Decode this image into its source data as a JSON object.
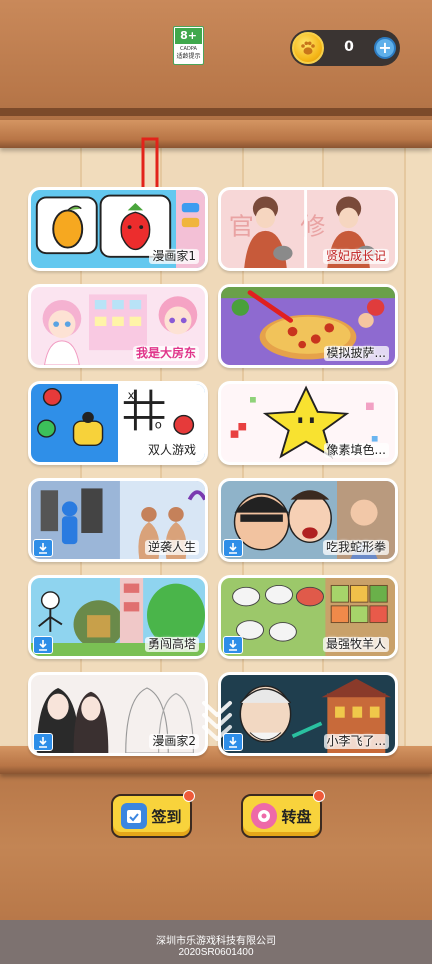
{
  "header": {
    "age_rating": "8+",
    "age_org": "CADPA",
    "age_tip": "适龄提示",
    "coin_count": "0",
    "coin_plus": "+"
  },
  "games": [
    {
      "label": "漫画家1",
      "download": false
    },
    {
      "label": "贤妃成长记",
      "download": false
    },
    {
      "label": "我是大房东",
      "download": false
    },
    {
      "label": "模拟披萨...",
      "download": false
    },
    {
      "label": "双人游戏",
      "download": false
    },
    {
      "label": "像素填色...",
      "download": false
    },
    {
      "label": "逆袭人生",
      "download": true
    },
    {
      "label": "吃我蛇形拳",
      "download": true
    },
    {
      "label": "勇闯高塔",
      "download": true
    },
    {
      "label": "最强牧羊人",
      "download": true
    },
    {
      "label": "漫画家2",
      "download": true
    },
    {
      "label": "小李飞了...",
      "download": true
    }
  ],
  "buttons": {
    "signin": "签到",
    "wheel": "转盘"
  },
  "footer": {
    "company": "深圳市乐游戏科技有限公司",
    "reg": "2020SR0601400"
  },
  "colors": {
    "accent_yellow": "#f8d33c",
    "badge_red": "#ef5a3a",
    "download_blue": "#2e8ee8"
  }
}
